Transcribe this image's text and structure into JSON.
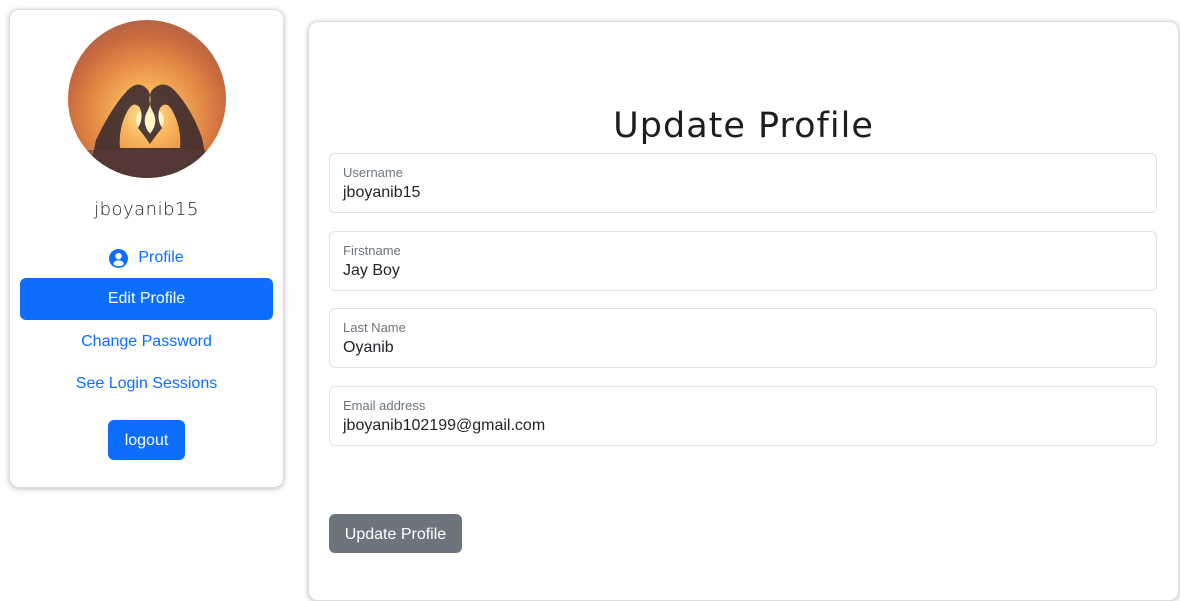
{
  "sidebar": {
    "username": "jboyanib15",
    "avatar_icon": "heart-hands-sunset-photo",
    "nav": {
      "profile_label": "Profile",
      "profile_icon": "user-circle-icon",
      "edit_profile_label": "Edit Profile",
      "change_password_label": "Change Password",
      "login_sessions_label": "See Login Sessions"
    },
    "logout_label": "logout"
  },
  "main": {
    "title": "Update Profile",
    "fields": [
      {
        "label": "Username",
        "value": "jboyanib15"
      },
      {
        "label": "Firstname",
        "value": "Jay Boy"
      },
      {
        "label": "Last Name",
        "value": "Oyanib"
      },
      {
        "label": "Email address",
        "value": "jboyanib102199@gmail.com"
      }
    ],
    "submit_label": "Update Profile"
  },
  "colors": {
    "primary": "#0d6efd",
    "secondary": "#6c757d"
  }
}
